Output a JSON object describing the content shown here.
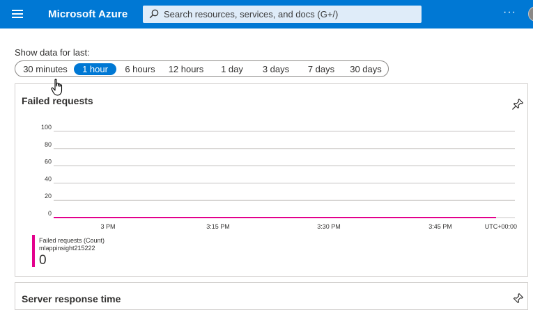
{
  "header": {
    "brand": "Microsoft Azure",
    "search_placeholder": "Search resources, services, and docs (G+/)",
    "more_label": "···"
  },
  "time_range": {
    "label": "Show data for last:",
    "options": [
      "30 minutes",
      "1 hour",
      "6 hours",
      "12 hours",
      "1 day",
      "3 days",
      "7 days",
      "30 days"
    ],
    "selected": "1 hour"
  },
  "failed_requests_card": {
    "title": "Failed requests",
    "legend": {
      "metric": "Failed requests (Count)",
      "resource": "mlappinsight215222",
      "value": "0",
      "color": "#e3008c"
    }
  },
  "server_response_card": {
    "title": "Server response time"
  },
  "chart_data": {
    "type": "line",
    "title": "Failed requests",
    "x": [
      "3 PM",
      "3:15 PM",
      "3:30 PM",
      "3:45 PM"
    ],
    "x_label": "UTC+00:00",
    "y_ticks": [
      "100",
      "80",
      "60",
      "40",
      "20",
      "0"
    ],
    "ylim": [
      0,
      100
    ],
    "series": [
      {
        "name": "Failed requests (Count)",
        "values": [
          0,
          0,
          0,
          0
        ],
        "color": "#e3008c"
      }
    ],
    "grid": true
  }
}
